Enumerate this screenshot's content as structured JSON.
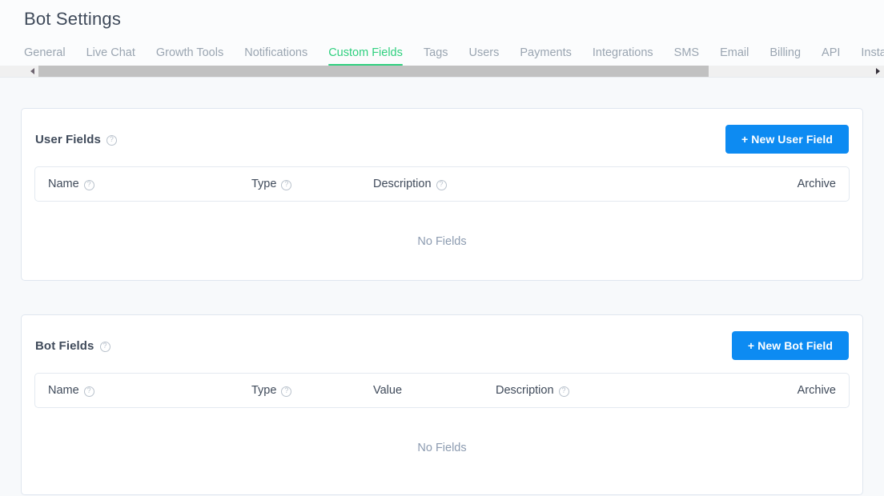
{
  "header": {
    "title": "Bot Settings"
  },
  "tabs": {
    "active": "Custom Fields",
    "items": [
      {
        "label": "General"
      },
      {
        "label": "Live Chat"
      },
      {
        "label": "Growth Tools"
      },
      {
        "label": "Notifications"
      },
      {
        "label": "Custom Fields"
      },
      {
        "label": "Tags"
      },
      {
        "label": "Users"
      },
      {
        "label": "Payments"
      },
      {
        "label": "Integrations"
      },
      {
        "label": "SMS"
      },
      {
        "label": "Email"
      },
      {
        "label": "Billing"
      },
      {
        "label": "API"
      },
      {
        "label": "Installed Temp"
      }
    ]
  },
  "scrollbar": {
    "left_arrow": "left-arrow-icon",
    "right_arrow": "right-arrow-icon"
  },
  "user_fields": {
    "title": "User Fields",
    "help_icon": "help-circle-icon",
    "button_label": "+ New User Field",
    "columns": [
      {
        "label": "Name",
        "help": true
      },
      {
        "label": "Type",
        "help": true
      },
      {
        "label": "Description",
        "help": true
      },
      {
        "label": "Archive",
        "help": false
      }
    ],
    "rows": [],
    "empty_text": "No Fields"
  },
  "bot_fields": {
    "title": "Bot Fields",
    "help_icon": "help-circle-icon",
    "button_label": "+ New Bot Field",
    "columns": [
      {
        "label": "Name",
        "help": true
      },
      {
        "label": "Type",
        "help": true
      },
      {
        "label": "Value",
        "help": false
      },
      {
        "label": "Description",
        "help": true
      },
      {
        "label": "Archive",
        "help": false
      }
    ],
    "rows": [],
    "empty_text": "No Fields"
  },
  "colors": {
    "accent_green": "#2fd07f",
    "primary_blue": "#0d8bf2",
    "page_bg": "#f7f9fb",
    "text_dark": "#3f4a5a",
    "text_muted": "#9aa5b1"
  }
}
